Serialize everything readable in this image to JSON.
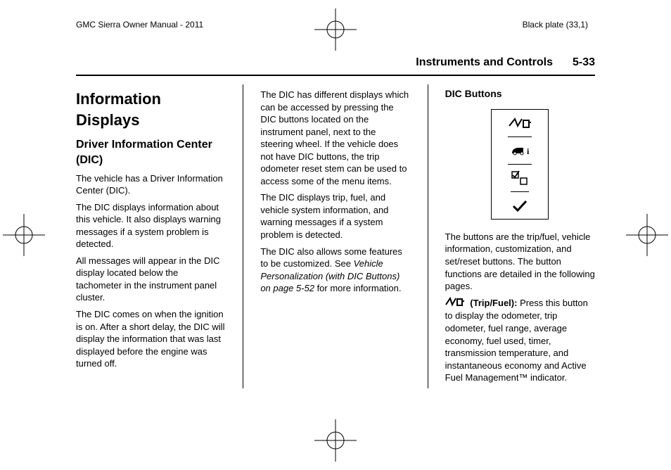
{
  "header": {
    "left": "GMC Sierra Owner Manual - 2011",
    "right": "Black plate (33,1)"
  },
  "runhead": {
    "section": "Instruments and Controls",
    "pageno": "5-33"
  },
  "col1": {
    "h1": "Information Displays",
    "h2": "Driver Information Center (DIC)",
    "p1": "The vehicle has a Driver Information Center (DIC).",
    "p2": "The DIC displays information about this vehicle. It also displays warning messages if a system problem is detected.",
    "p3": "All messages will appear in the DIC display located below the tachometer in the instrument panel cluster.",
    "p4": "The DIC comes on when the ignition is on. After a short delay, the DIC will display the information that was last displayed before the engine was turned off."
  },
  "col2": {
    "p1": "The DIC has different displays which can be accessed by pressing the DIC buttons located on the instrument panel, next to the steering wheel. If the vehicle does not have DIC buttons, the trip odometer reset stem can be used to access some of the menu items.",
    "p2": "The DIC displays trip, fuel, and vehicle system information, and warning messages if a system problem is detected.",
    "p3a": "The DIC also allows some features to be customized. See ",
    "p3i": "Vehicle Personalization (with DIC Buttons) on page 5-52",
    "p3b": " for more information."
  },
  "col3": {
    "h3": "DIC Buttons",
    "p1": "The buttons are the trip/fuel, vehicle information, customization, and set/reset buttons. The button functions are detailed in the following pages.",
    "tripLabel": "(Trip/Fuel):",
    "tripBody": "  Press this button to display the odometer, trip odometer, fuel range, average economy, fuel used, timer, transmission temperature, and instantaneous economy and Active Fuel Management™ indicator."
  }
}
